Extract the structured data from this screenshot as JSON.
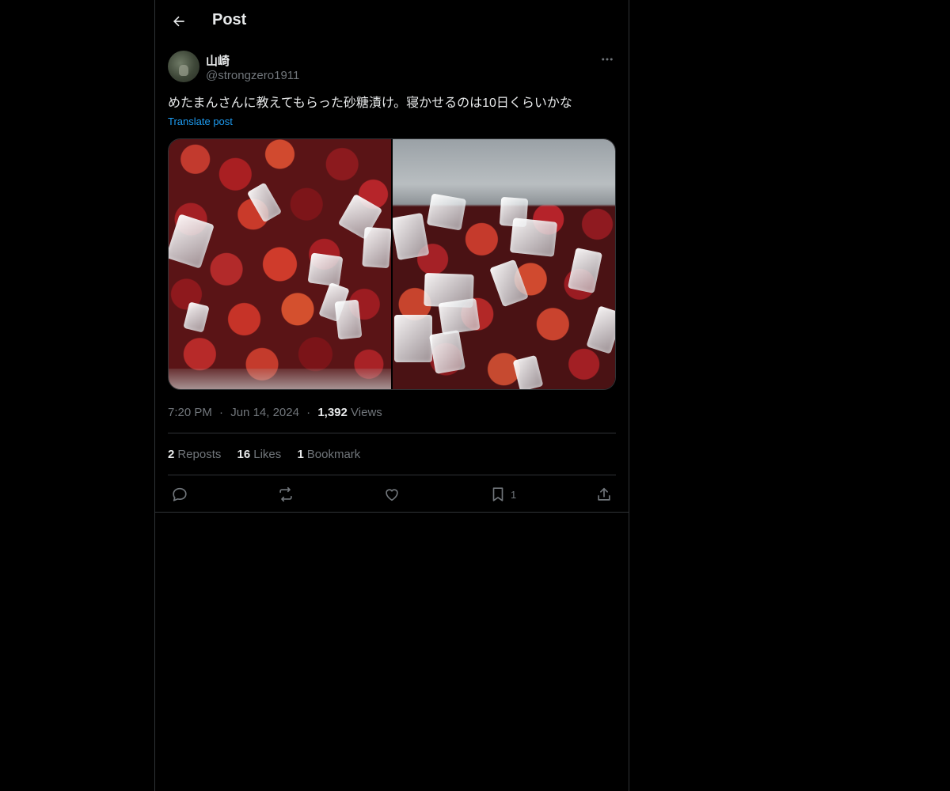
{
  "header": {
    "title": "Post",
    "back_icon": "arrow-left-icon"
  },
  "post": {
    "author": {
      "display_name": "山崎",
      "handle": "@strongzero1911"
    },
    "text": "めたまんさんに教えてもらった砂糖漬け。寝かせるのは10日くらいかな",
    "translate_label": "Translate post",
    "media_count": 2,
    "timestamp": {
      "time": "7:20 PM",
      "separator": "·",
      "date": "Jun 14, 2024",
      "views_count": "1,392",
      "views_label": "Views"
    },
    "stats": {
      "reposts_count": "2",
      "reposts_label": "Reposts",
      "likes_count": "16",
      "likes_label": "Likes",
      "bookmarks_count": "1",
      "bookmarks_label": "Bookmark"
    },
    "actions": {
      "reply_icon": "reply-icon",
      "repost_icon": "repost-icon",
      "like_icon": "heart-icon",
      "bookmark_icon": "bookmark-icon",
      "bookmark_count": "1",
      "share_icon": "share-icon"
    }
  },
  "colors": {
    "background": "#000000",
    "text_primary": "#e7e9ea",
    "text_secondary": "#71767b",
    "link": "#1d9bf0",
    "border": "#2f3336"
  }
}
